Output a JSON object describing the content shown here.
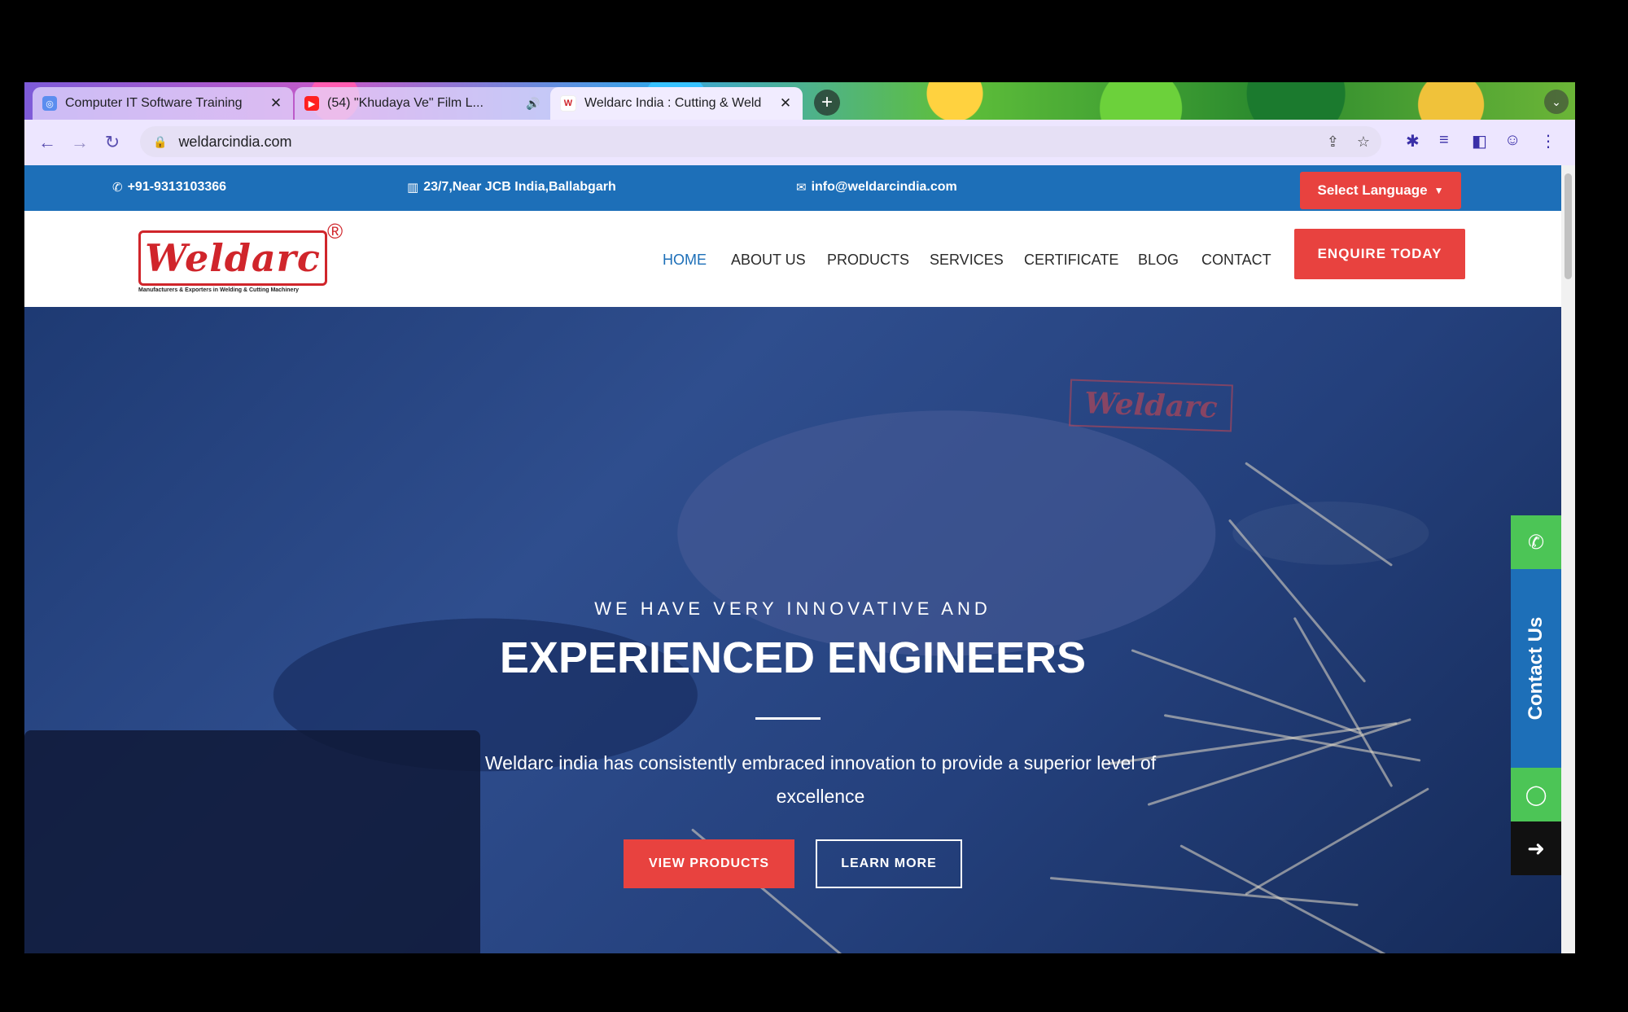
{
  "browser": {
    "tabs": [
      {
        "title": "Computer IT Software Training",
        "favicon": "globe-icon",
        "active": false
      },
      {
        "title": "(54) \"Khudaya Ve\" Film L...",
        "favicon": "youtube-icon",
        "active": false
      },
      {
        "title": "Weldarc India : Cutting & Weld",
        "favicon": "weldarc-icon",
        "active": true
      }
    ],
    "url": "weldarcindia.com"
  },
  "topbar": {
    "phone": "+91-9313103366",
    "address": "23/7,Near JCB India,Ballabgarh",
    "email": "info@weldarcindia.com",
    "language_button": "Select Language"
  },
  "header": {
    "logo_text": "Weldarc",
    "logo_reg": "®",
    "logo_tagline": "Manufacturers & Exporters in Welding & Cutting Machinery",
    "nav": [
      "HOME",
      "ABOUT US",
      "PRODUCTS",
      "SERVICES",
      "CERTIFICATE",
      "BLOG",
      "CONTACT"
    ],
    "active_nav": "HOME",
    "enquire_button": "ENQUIRE TODAY"
  },
  "hero": {
    "subtitle": "WE HAVE VERY INNOVATIVE AND",
    "title": "EXPERIENCED ENGINEERS",
    "description": "Weldarc india has consistently embraced innovation to provide a superior level of excellence",
    "primary_button": "VIEW PRODUCTS",
    "secondary_button": "LEARN MORE",
    "shirt_logo": "Weldarc"
  },
  "side_widget": {
    "contact_label": "Contact Us"
  },
  "colors": {
    "brand_blue": "#1d6fb8",
    "brand_red": "#e8423f",
    "whatsapp_green": "#4cc556"
  }
}
